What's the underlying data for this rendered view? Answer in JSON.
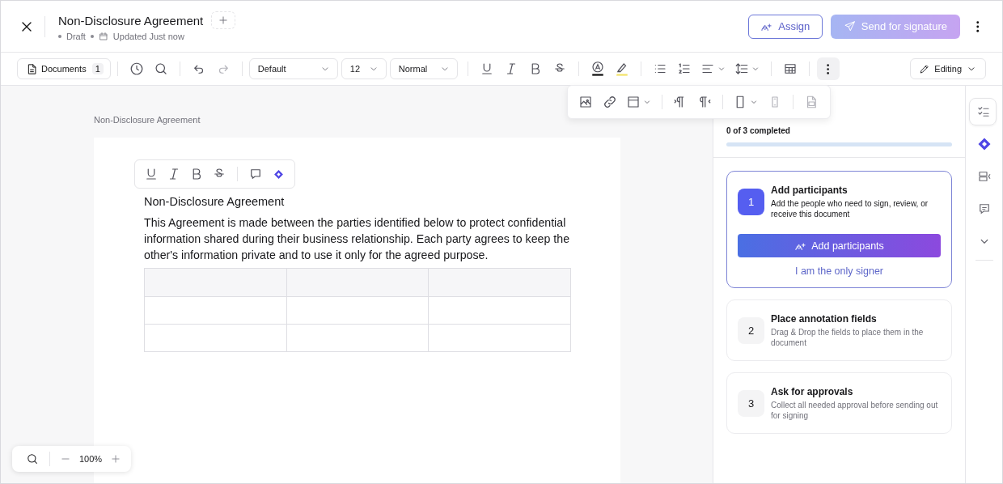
{
  "header": {
    "title": "Non-Disclosure Agreement",
    "status": "Draft",
    "updated": "Updated Just now"
  },
  "actions": [
    {
      "label": "Assign",
      "kind": "outline",
      "disabled": false
    },
    {
      "label": "Send for signature",
      "kind": "primary",
      "disabled": true
    }
  ],
  "toolbar": {
    "documents": "Documents",
    "count": "1",
    "font": "Default",
    "size": "12",
    "style": "Normal",
    "mode": "Editing",
    "more_expanded": true
  },
  "document": {
    "breadcrumb": "Non-Disclosure Agreement",
    "heading": "Non-Disclosure Agreement",
    "paragraph": "This Agreement is made between the parties identified below to protect confidential information shared during their business relationship. Each party agrees to keep the other's information private and to use it only for the agreed purpose."
  },
  "checklist": {
    "summary": "0 of 3 completed",
    "level": 0,
    "steps": [
      {
        "number": "1",
        "title": "Add participants",
        "description": "Add the people who need to sign, review, or receive this document",
        "active": true,
        "actions": [
          {
            "label": "Add participants",
            "kind": "primary"
          },
          {
            "label": "I am the only signer",
            "kind": "link"
          }
        ]
      },
      {
        "number": "2",
        "title": "Place annotation fields",
        "description": "Drag & Drop the fields to place them in the document",
        "active": false
      },
      {
        "number": "3",
        "title": "Ask for approvals",
        "description": "Collect all needed approval before sending out for signing",
        "active": false
      }
    ]
  },
  "rail": [
    {
      "selected": true
    },
    {
      "selected": false
    },
    {
      "selected": false
    },
    {
      "selected": false
    }
  ],
  "zoom": "100%"
}
